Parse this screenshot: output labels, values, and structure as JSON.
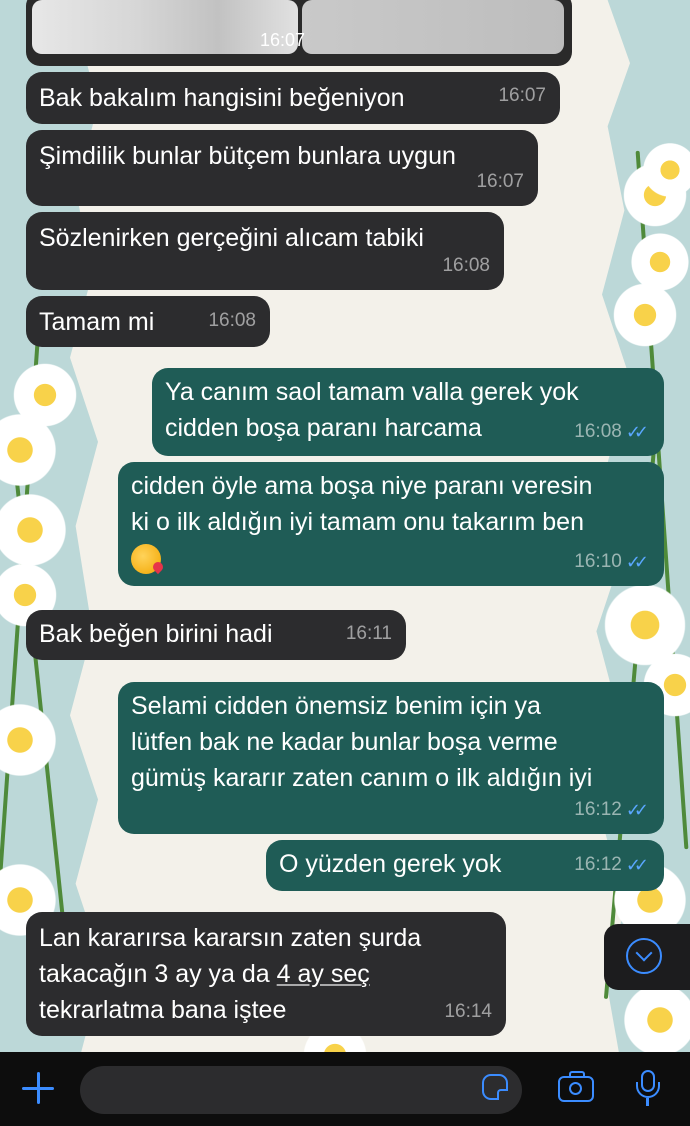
{
  "top_image": {
    "time": "16:07"
  },
  "messages": [
    {
      "dir": "in",
      "lines": [
        "Bak bakalım hangisini beğeniyon"
      ],
      "time": "16:07"
    },
    {
      "dir": "in",
      "lines": [
        "Şimdilik bunlar bütçem bunlara uygun"
      ],
      "time": "16:07"
    },
    {
      "dir": "in",
      "lines": [
        "Sözlenirken gerçeğini alıcam tabiki"
      ],
      "time": "16:08"
    },
    {
      "dir": "in",
      "lines": [
        "Tamam mi"
      ],
      "time": "16:08"
    },
    {
      "dir": "out",
      "lines": [
        "Ya canım saol tamam valla gerek yok",
        "cidden boşa paranı harcama"
      ],
      "time": "16:08",
      "read": true
    },
    {
      "dir": "out",
      "lines": [
        "cidden öyle ama boşa niye paranı veresin",
        "ki o ilk aldığın iyi tamam onu takarım ben"
      ],
      "emoji": "kissing-face-heart",
      "time": "16:10",
      "read": true
    },
    {
      "dir": "in",
      "lines": [
        "Bak beğen birini hadi"
      ],
      "time": "16:11"
    },
    {
      "dir": "out",
      "lines": [
        "Selami cidden önemsiz benim için ya",
        "lütfen bak ne kadar bunlar boşa verme",
        "gümüş kararır zaten canım o ilk aldığın iyi"
      ],
      "time": "16:12",
      "read": true
    },
    {
      "dir": "out",
      "lines": [
        "O yüzden gerek yok"
      ],
      "time": "16:12",
      "read": true
    },
    {
      "dir": "in",
      "lines": [
        "Lan kararırsa kararsın zaten şurda",
        "takacağın 3 ay ya da ",
        "tekrarlatma bana iştee"
      ],
      "underlined": "4 ay seç",
      "time": "16:14"
    }
  ],
  "ticks": "✓✓",
  "composer": {
    "placeholder": ""
  },
  "colors": {
    "incoming": "#2c2c2e",
    "outgoing": "#1f5c56",
    "accent": "#3b8cff",
    "read_ticks": "#5aa7ff"
  },
  "icons": [
    "plus-icon",
    "sticker-icon",
    "camera-icon",
    "microphone-icon",
    "scroll-down-icon",
    "double-check-icon"
  ]
}
